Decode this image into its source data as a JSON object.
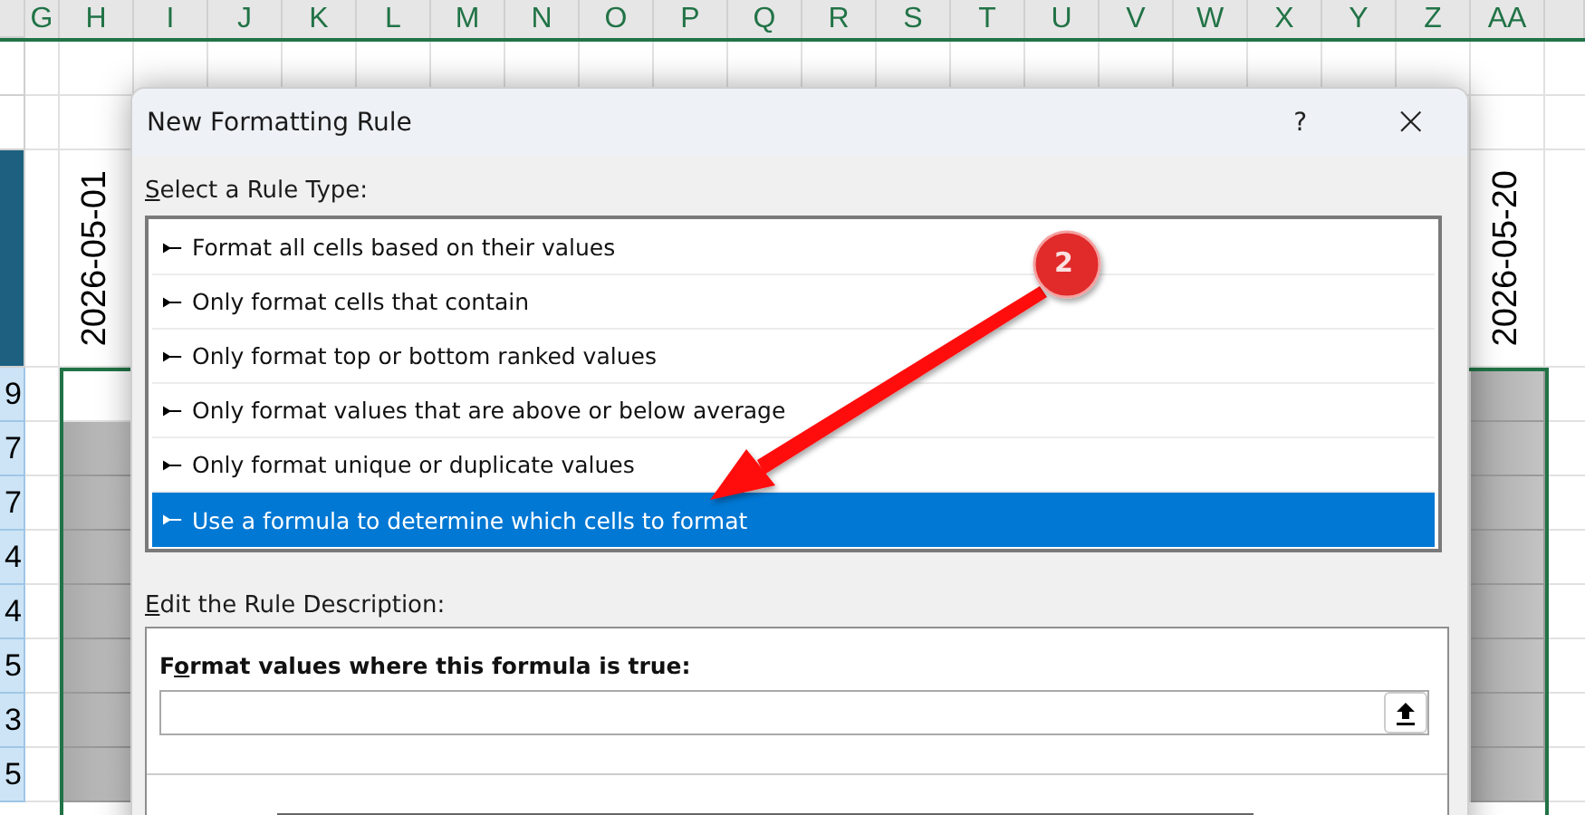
{
  "sheet": {
    "columns": [
      "G",
      "H",
      "I",
      "J",
      "K",
      "L",
      "M",
      "N",
      "O",
      "P",
      "Q",
      "R",
      "S",
      "T",
      "U",
      "V",
      "W",
      "X",
      "Y",
      "Z",
      "AA"
    ],
    "date_headers": [
      "2026-05-01",
      "2026-05-20"
    ],
    "row_numbers": [
      "9",
      "7",
      "7",
      "4",
      "4",
      "5",
      "3",
      "5"
    ]
  },
  "dialog": {
    "title": "New Formatting Rule",
    "help": "?",
    "close": "×",
    "rule_type_label": {
      "key": "S",
      "after": "elect a Rule Type:"
    },
    "rule_types": [
      {
        "label": "Format all cells based on their values",
        "selected": false
      },
      {
        "label": "Only format cells that contain",
        "selected": false
      },
      {
        "label": "Only format top or bottom ranked values",
        "selected": false
      },
      {
        "label": "Only format values that are above or below average",
        "selected": false
      },
      {
        "label": "Only format unique or duplicate values",
        "selected": false
      },
      {
        "label": "Use a formula to determine which cells to format",
        "selected": true
      }
    ],
    "description_label": {
      "key": "E",
      "after": "dit the Rule Description:"
    },
    "formula_label": {
      "before": "F",
      "key": "o",
      "after": "rmat values where this formula is true:"
    }
  },
  "annotation": {
    "number": "2"
  }
}
